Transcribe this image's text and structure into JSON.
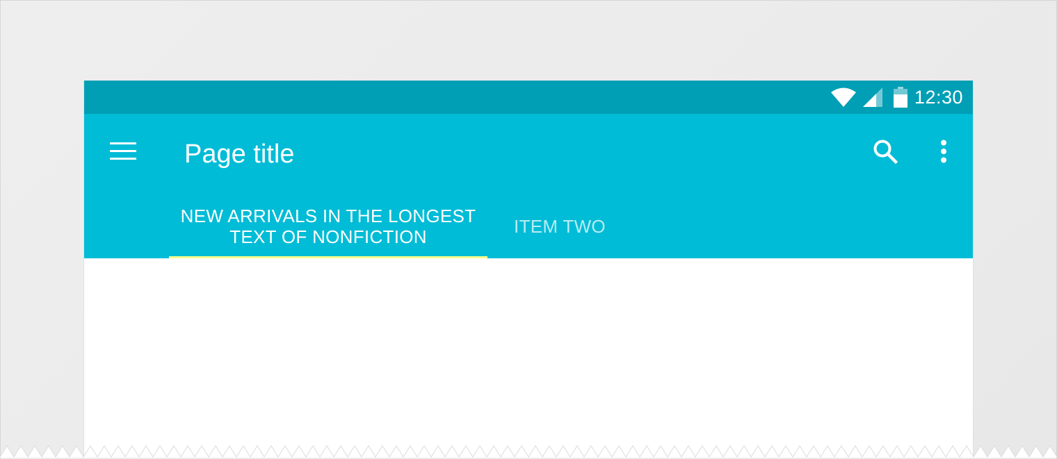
{
  "status_bar": {
    "time": "12:30",
    "icons": [
      "wifi-icon",
      "cell-signal-icon",
      "battery-icon"
    ],
    "color": "#009fb5"
  },
  "app_bar": {
    "title": "Page title",
    "color": "#00bcd6",
    "icons": [
      "menu-icon",
      "search-icon",
      "more-vert-icon"
    ]
  },
  "tabs": [
    {
      "label": "NEW ARRIVALS IN THE LONGEST TEXT OF NONFICTION",
      "selected": true
    },
    {
      "label": "ITEM TWO",
      "selected": false
    }
  ],
  "colors": {
    "tab_indicator": "#ffff8d",
    "background": "#eeeeee",
    "content": "#ffffff"
  }
}
